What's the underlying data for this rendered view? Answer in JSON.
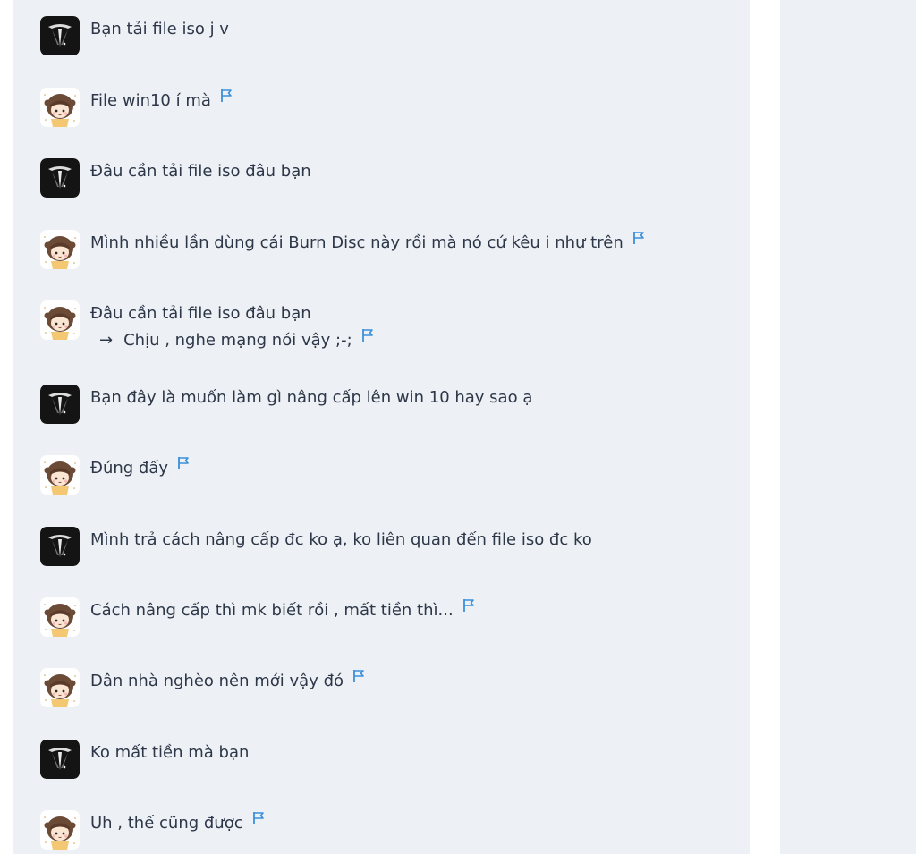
{
  "colors": {
    "panel_bg": "#edf0f4",
    "text": "#2d3748",
    "flag": "#3b8fd9",
    "avatar_dark": "#141414"
  },
  "messages": [
    {
      "avatar": "tri-logo-icon",
      "lines": [
        "Bạn tải file iso j v"
      ],
      "flag": false
    },
    {
      "avatar": "chibi-girl-avatar",
      "lines": [
        "File win10 í mà"
      ],
      "flag": true
    },
    {
      "avatar": "tri-logo-icon",
      "lines": [
        "Đâu cần tải file iso đâu bạn"
      ],
      "flag": false
    },
    {
      "avatar": "chibi-girl-avatar",
      "lines": [
        "Mình nhiều lần dùng cái Burn Disc này rồi mà nó cứ kêu i như trên"
      ],
      "flag": true
    },
    {
      "avatar": "chibi-girl-avatar",
      "lines": [
        "Đâu cần tải file iso đâu bạn"
      ],
      "reply": {
        "arrow": "→",
        "text": "Chịu , nghe mạng nói vậy ;-;"
      },
      "flag": true
    },
    {
      "avatar": "tri-logo-icon",
      "lines": [
        "Bạn đây là muốn làm gì nâng cấp lên win 10 hay sao ạ"
      ],
      "flag": false
    },
    {
      "avatar": "chibi-girl-avatar",
      "lines": [
        "Đúng đấy"
      ],
      "flag": true
    },
    {
      "avatar": "tri-logo-icon",
      "lines": [
        "Mình trả cách nâng cấp đc ko ạ, ko liên quan đến file iso đc ko"
      ],
      "flag": false
    },
    {
      "avatar": "chibi-girl-avatar",
      "lines": [
        "Cách nâng cấp thì mk biết rồi , mất tiền thì..."
      ],
      "flag": true
    },
    {
      "avatar": "chibi-girl-avatar",
      "lines": [
        "Dân nhà nghèo nên mới vậy đó"
      ],
      "flag": true
    },
    {
      "avatar": "tri-logo-icon",
      "lines": [
        "Ko mất tiền mà bạn"
      ],
      "flag": false
    },
    {
      "avatar": "chibi-girl-avatar",
      "lines": [
        "Uh , thế cũng được"
      ],
      "flag": true
    }
  ]
}
